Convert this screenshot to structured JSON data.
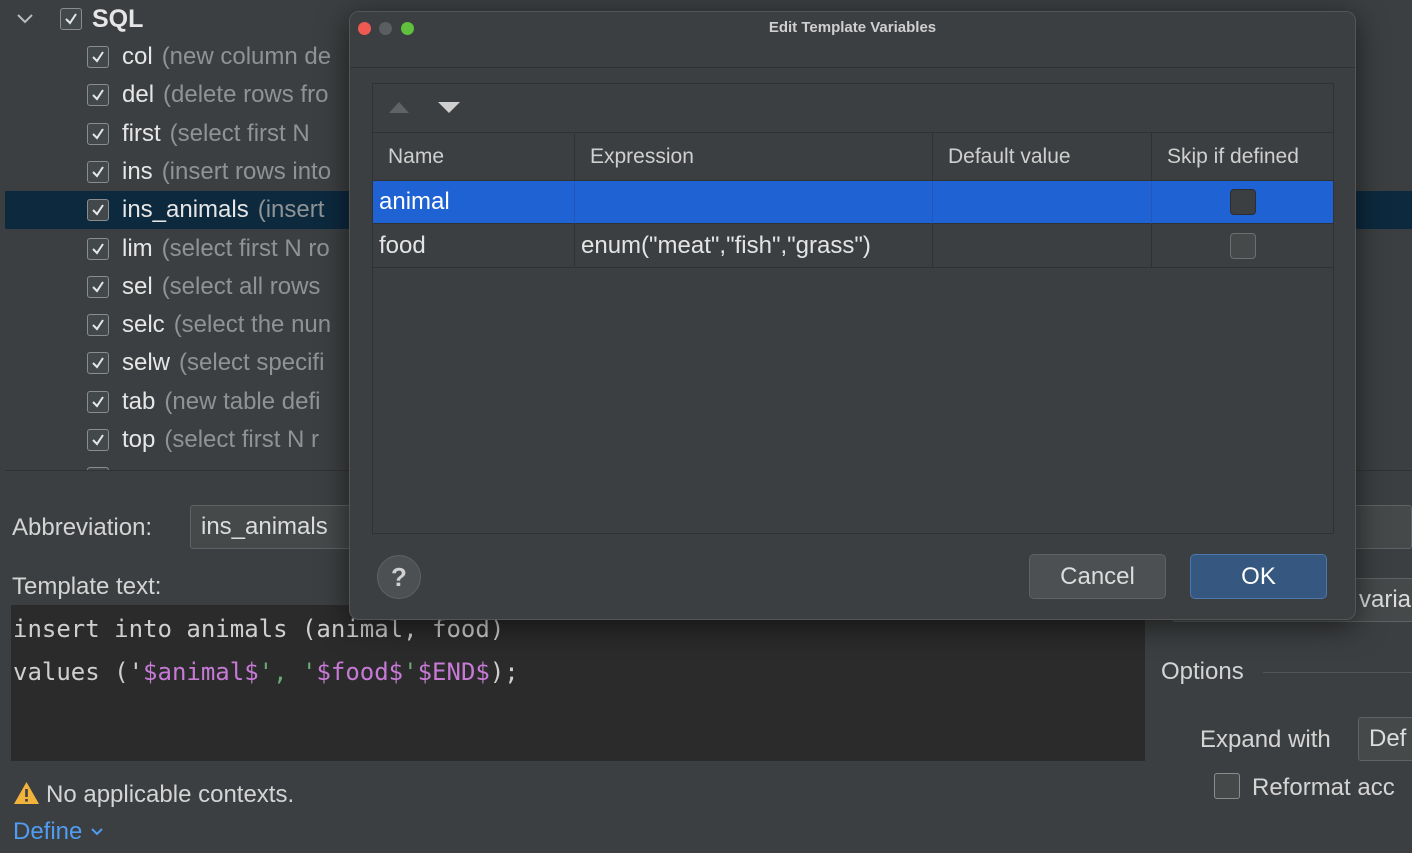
{
  "tree": {
    "group": {
      "label": "SQL",
      "checked": true,
      "icon": "chevron-down-icon"
    },
    "items": [
      {
        "name": "col",
        "desc": "(new column de"
      },
      {
        "name": "del",
        "desc": "(delete rows fro"
      },
      {
        "name": "first",
        "desc": "(select first N"
      },
      {
        "name": "ins",
        "desc": "(insert rows into"
      },
      {
        "name": "ins_animals",
        "desc": "(insert",
        "selected": true
      },
      {
        "name": "lim",
        "desc": "(select first N ro"
      },
      {
        "name": "sel",
        "desc": "(select all rows"
      },
      {
        "name": "selc",
        "desc": "(select the nun"
      },
      {
        "name": "selw",
        "desc": "(select specifi"
      },
      {
        "name": "tab",
        "desc": "(new table defi"
      },
      {
        "name": "top",
        "desc": "(select first N r"
      }
    ]
  },
  "abbreviation": {
    "label": "Abbreviation:",
    "value": "ins_animals"
  },
  "template_text": {
    "label": "Template text:",
    "line1": "insert into animals (animal, food)",
    "line2_prefix": "values ('",
    "line2_var1": "$animal$",
    "line2_mid1": "', '",
    "line2_var2": "$food$",
    "line2_mid2": "'",
    "line2_var3": "$END$",
    "line2_suffix": ");"
  },
  "warning": {
    "text": "No applicable contexts.",
    "icon": "warning-icon"
  },
  "define_link": "Define",
  "right_panel": {
    "edit_vars_partial": "varia",
    "options_label": "Options",
    "expand_with_label": "Expand with",
    "expand_with_value": "Def",
    "reformat_label": "Reformat acc"
  },
  "dialog": {
    "title": "Edit Template Variables",
    "columns": [
      "Name",
      "Expression",
      "Default value",
      "Skip if defined"
    ],
    "rows": [
      {
        "name": "animal",
        "expression": "",
        "default": "",
        "skip": false,
        "selected": true
      },
      {
        "name": "food",
        "expression": "enum(\"meat\",\"fish\",\"grass\")",
        "default": "",
        "skip": false,
        "selected": false
      }
    ],
    "help_label": "?",
    "cancel_label": "Cancel",
    "ok_label": "OK",
    "colors": {
      "selection": "#1f62d3",
      "ok_button": "#365880",
      "close": "#ee5a52",
      "zoom": "#5fc13e"
    }
  }
}
